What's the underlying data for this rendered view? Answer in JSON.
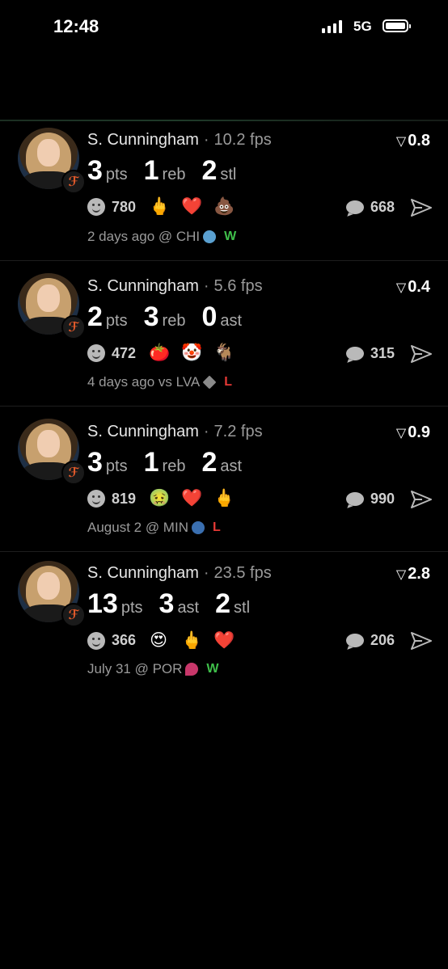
{
  "status_bar": {
    "time": "12:48",
    "network": "5G"
  },
  "cards": [
    {
      "name": "S. Cunningham",
      "sep": "·",
      "fps": "10.2 fps",
      "score": "0.8",
      "stats": [
        {
          "num": "3",
          "unit": "pts"
        },
        {
          "num": "1",
          "unit": "reb"
        },
        {
          "num": "2",
          "unit": "stl"
        }
      ],
      "reaction_count": "780",
      "emojis": [
        "🖕",
        "❤️",
        "💩"
      ],
      "comments": "668",
      "meta": "2 days ago @ CHI",
      "opponent_color": "#5aa0d0",
      "result": "W"
    },
    {
      "name": "S. Cunningham",
      "sep": "·",
      "fps": "5.6 fps",
      "score": "0.4",
      "stats": [
        {
          "num": "2",
          "unit": "pts"
        },
        {
          "num": "3",
          "unit": "reb"
        },
        {
          "num": "0",
          "unit": "ast"
        }
      ],
      "reaction_count": "472",
      "emojis": [
        "🍅",
        "🤡",
        "🐐"
      ],
      "comments": "315",
      "meta": "4 days ago vs LVA",
      "opponent_color": "#8a8a8a",
      "result": "L"
    },
    {
      "name": "S. Cunningham",
      "sep": "·",
      "fps": "7.2 fps",
      "score": "0.9",
      "stats": [
        {
          "num": "3",
          "unit": "pts"
        },
        {
          "num": "1",
          "unit": "reb"
        },
        {
          "num": "2",
          "unit": "ast"
        }
      ],
      "reaction_count": "819",
      "emojis": [
        "🤢",
        "❤️",
        "🖕"
      ],
      "comments": "990",
      "meta": "August 2 @ MIN",
      "opponent_color": "#3a6fb0",
      "result": "L"
    },
    {
      "name": "S. Cunningham",
      "sep": "·",
      "fps": "23.5 fps",
      "score": "2.8",
      "stats": [
        {
          "num": "13",
          "unit": "pts"
        },
        {
          "num": "3",
          "unit": "ast"
        },
        {
          "num": "2",
          "unit": "stl"
        }
      ],
      "reaction_count": "366",
      "emojis": [
        "😍",
        "🖕",
        "❤️"
      ],
      "comments": "206",
      "meta": "July 31 @ POR",
      "opponent_color": "#c8376a",
      "result": "W"
    }
  ]
}
